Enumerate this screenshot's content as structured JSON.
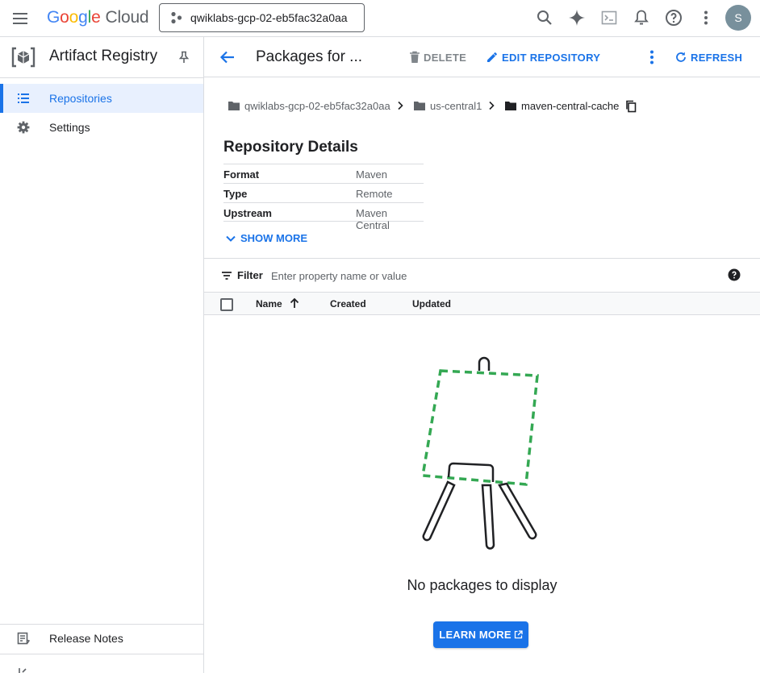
{
  "topbar": {
    "logo_parts": [
      "G",
      "o",
      "o",
      "g",
      "l",
      "e"
    ],
    "logo_cloud": "Cloud",
    "project_name": "qwiklabs-gcp-02-eb5fac32a0aa",
    "avatar_letter": "S",
    "icons": [
      "menu-icon",
      "search-icon",
      "gemini-spark-icon",
      "cloud-shell-icon",
      "notifications-icon",
      "help-icon",
      "more-vert-icon"
    ]
  },
  "sidebar": {
    "title": "Artifact Registry",
    "items": [
      {
        "label": "Repositories",
        "icon": "list-icon",
        "active": true
      },
      {
        "label": "Settings",
        "icon": "gear-icon",
        "active": false
      }
    ],
    "release_notes": "Release Notes"
  },
  "header": {
    "title": "Packages for ...",
    "delete_label": "DELETE",
    "edit_label": "EDIT REPOSITORY",
    "refresh_label": "REFRESH"
  },
  "breadcrumb": [
    {
      "label": "qwiklabs-gcp-02-eb5fac32a0aa"
    },
    {
      "label": "us-central1"
    },
    {
      "label": "maven-central-cache"
    }
  ],
  "details": {
    "title": "Repository Details",
    "rows": [
      {
        "key": "Format",
        "value": "Maven"
      },
      {
        "key": "Type",
        "value": "Remote"
      },
      {
        "key": "Upstream",
        "value": "Maven Central"
      }
    ],
    "show_more": "SHOW MORE"
  },
  "filter": {
    "label": "Filter",
    "placeholder": "Enter property name or value",
    "value": ""
  },
  "table": {
    "columns": [
      "Name",
      "Created",
      "Updated"
    ]
  },
  "empty": {
    "message": "No packages to display",
    "button": "LEARN MORE"
  },
  "colors": {
    "accent": "#1a73e8",
    "empty_canvas": "#34a853",
    "active_bg": "#e8f0fe"
  }
}
